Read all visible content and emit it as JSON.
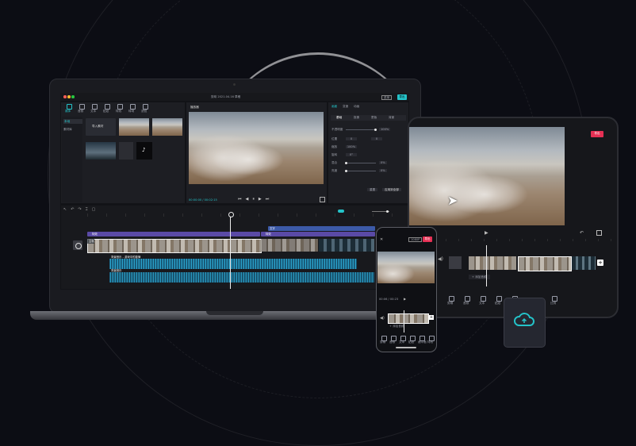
{
  "laptop": {
    "title_bar": "剪映 2021.04.16 草稿",
    "export_label": "导出",
    "menu_label": "菜单",
    "media_tabs": [
      "媒体",
      "音频",
      "文本",
      "贴纸",
      "特效",
      "转场",
      "滤镜"
    ],
    "side_items": [
      "本地",
      "素材库"
    ],
    "import_label": "导入素材",
    "player_title": "播放器",
    "timecode": "00:00:00 / 00:02:15",
    "inspector_tabs": [
      "画面",
      "变速",
      "动画",
      "调节"
    ],
    "inspector_subtabs": [
      "基础",
      "抠像",
      "蒙版",
      "背景"
    ],
    "inspector_rows": [
      "不透明度",
      "位置",
      "缩放",
      "旋转",
      "混合",
      "亮度"
    ],
    "inspector_values": [
      "100%",
      "0",
      "100%",
      "0°",
      "0%",
      "0%"
    ],
    "reset_label": "重置",
    "apply_all_label": "应用到全部",
    "track_labels": [
      "主轨",
      "特效",
      "音频",
      "背景音乐"
    ],
    "text_track_label": "文字",
    "audio_label": "背景音乐 - 游戏中的旋律",
    "accent_cyan": "#24c3c9",
    "accent_red": "#e63054"
  },
  "tablet": {
    "export_label": "导出",
    "add_label": "+",
    "audio_hint": "+ 添加音频",
    "toolbar": [
      "剪辑",
      "音频",
      "文本",
      "贴纸",
      "画中画",
      "特效",
      "滤镜",
      "比例",
      "背景"
    ]
  },
  "phone": {
    "export_label": "导出",
    "timecode": "00:06 / 00:23",
    "audio_hint": "+ 添加音频",
    "toolbar": [
      "剪辑",
      "音频",
      "文本",
      "贴纸",
      "画中画",
      "特效"
    ]
  },
  "cloud": {
    "icon": "cloud-icon"
  }
}
